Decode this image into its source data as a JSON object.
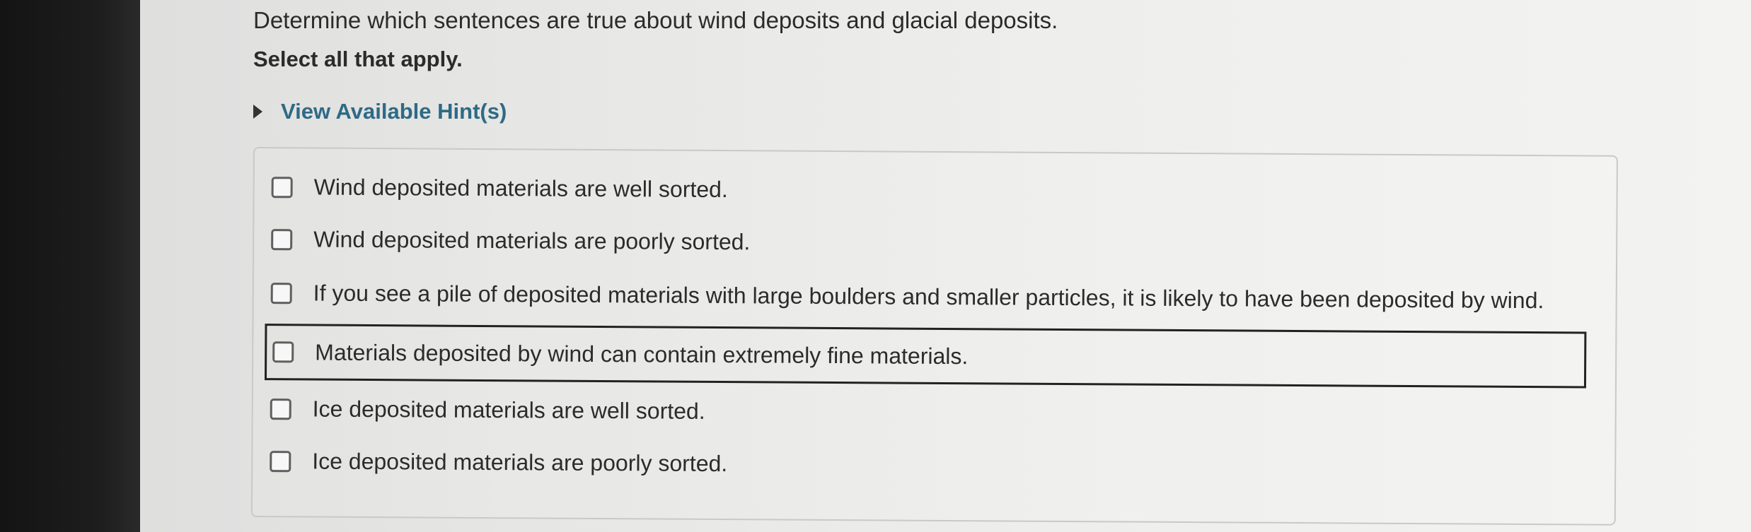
{
  "question": {
    "prompt": "Determine which sentences are true about wind deposits and glacial deposits.",
    "instruction": "Select all that apply."
  },
  "hint": {
    "label": "View Available Hint(s)",
    "expanded": false
  },
  "options": [
    {
      "label": "Wind deposited materials are well sorted.",
      "checked": false
    },
    {
      "label": "Wind deposited materials are poorly sorted.",
      "checked": false
    },
    {
      "label": "If you see a pile of deposited materials with large boulders and smaller particles, it is likely to have been deposited by wind.",
      "checked": false
    },
    {
      "label": "Materials deposited by wind can contain extremely fine materials.",
      "checked": false,
      "focused": true
    },
    {
      "label": "Ice deposited materials are well sorted.",
      "checked": false
    },
    {
      "label": "Ice deposited materials are poorly sorted.",
      "checked": false
    }
  ],
  "colors": {
    "link": "#2e6a86",
    "text": "#2b2b2b",
    "bezel": "#1a1a1a"
  }
}
